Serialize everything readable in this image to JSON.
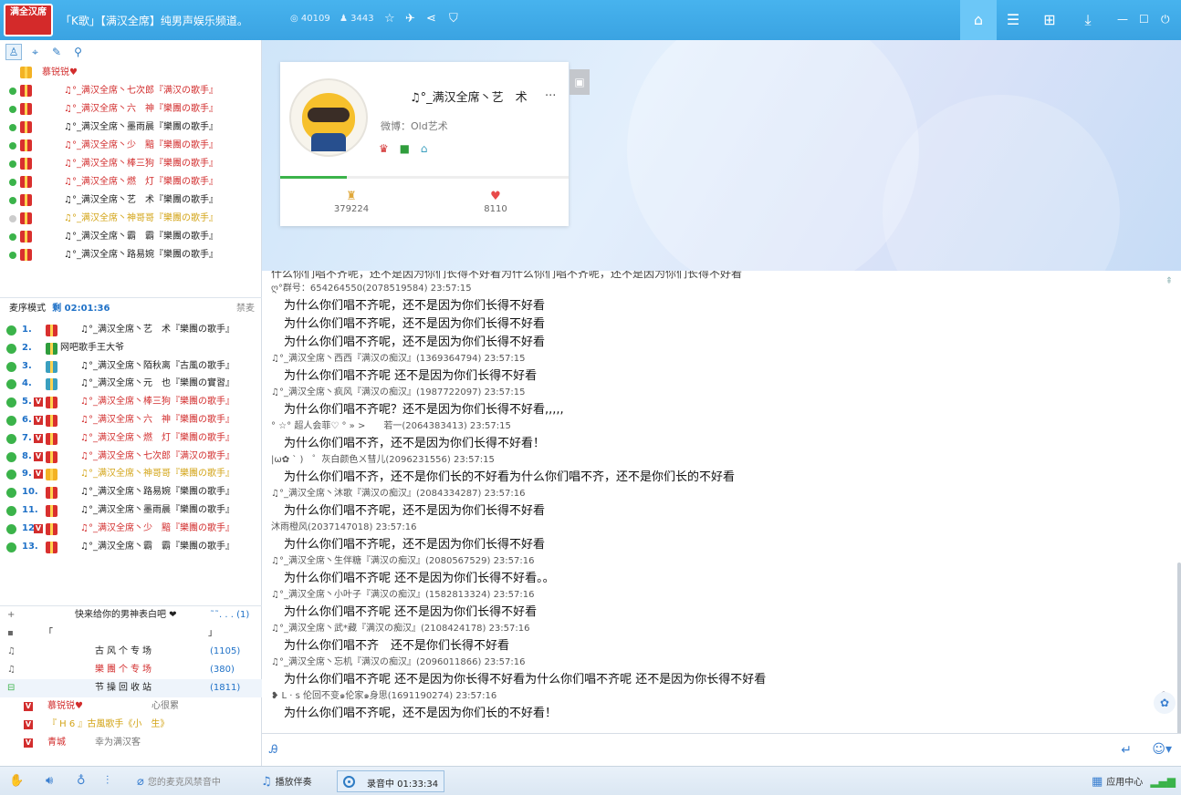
{
  "titlebar": {
    "logo": "满全汉席",
    "room_title": "「K歌」【满汉全席】纯男声娱乐频道。",
    "online": "40109",
    "members": "3443",
    "icons": [
      "star-icon",
      "plane-icon",
      "share-icon",
      "shield-icon"
    ],
    "right_icons": [
      "home-icon",
      "list-icon",
      "game-icon",
      "download-icon"
    ],
    "window": [
      "minimize-icon",
      "maximize-icon",
      "power-icon"
    ]
  },
  "left_tabs": [
    "user-icon",
    "location-icon",
    "edit-icon",
    "search-icon"
  ],
  "mic_list": {
    "host": "慕锐锐♥",
    "items": [
      {
        "name": "♫°_满汉全席丶七次郎『满汉の歌手』",
        "color": "red"
      },
      {
        "name": "♫°_满汉全席丶六　神『樂團の歌手』",
        "color": "red"
      },
      {
        "name": "♫°_满汉全席丶墨雨晨『樂團の歌手』",
        "color": "black"
      },
      {
        "name": "♫°_满汉全席丶少　黯『樂團の歌手』",
        "color": "red"
      },
      {
        "name": "♫°_满汉全席丶棒三狗『樂團の歌手』",
        "color": "red"
      },
      {
        "name": "♫°_满汉全席丶燃　灯『樂團の歌手』",
        "color": "red"
      },
      {
        "name": "♫°_满汉全席丶艺　术『樂團の歌手』",
        "color": "black"
      },
      {
        "name": "♫°_满汉全席丶神哥哥『樂團の歌手』",
        "color": "gold"
      },
      {
        "name": "♫°_满汉全席丶霸　霸『樂團の歌手』",
        "color": "black"
      },
      {
        "name": "♫°_满汉全席丶路易婉『樂團の歌手』",
        "color": "black"
      }
    ]
  },
  "queue": {
    "mode": "麦序模式",
    "remaining": "剩 02:01:36",
    "ban": "禁麦",
    "items": [
      {
        "num": "1.",
        "v": false,
        "name": "♫°_满汉全席丶艺　术『樂團の歌手』",
        "color": "black"
      },
      {
        "num": "2.",
        "v": false,
        "name": "网吧歌手王大爷",
        "color": "black"
      },
      {
        "num": "3.",
        "v": false,
        "name": "♫°_满汉全席丶陌秋离『古風の歌手』",
        "color": "black"
      },
      {
        "num": "4.",
        "v": false,
        "name": "♫°_满汉全席丶元　也『樂團の實習』",
        "color": "black"
      },
      {
        "num": "5.",
        "v": true,
        "name": "♫°_满汉全席丶棒三狗『樂團の歌手』",
        "color": "red"
      },
      {
        "num": "6.",
        "v": true,
        "name": "♫°_满汉全席丶六　神『樂團の歌手』",
        "color": "red"
      },
      {
        "num": "7.",
        "v": true,
        "name": "♫°_满汉全席丶燃　灯『樂團の歌手』",
        "color": "red"
      },
      {
        "num": "8.",
        "v": true,
        "name": "♫°_满汉全席丶七次郎『满汉の歌手』",
        "color": "red"
      },
      {
        "num": "9.",
        "v": true,
        "name": "♫°_满汉全席丶神哥哥『樂團の歌手』",
        "color": "gold"
      },
      {
        "num": "10.",
        "v": false,
        "name": "♫°_满汉全席丶路易婉『樂團の歌手』",
        "color": "black"
      },
      {
        "num": "11.",
        "v": false,
        "name": "♫°_满汉全席丶墨雨晨『樂團の歌手』",
        "color": "black"
      },
      {
        "num": "12.",
        "v": true,
        "name": "♫°_满汉全席丶少　黯『樂團の歌手』",
        "color": "red"
      },
      {
        "num": "13.",
        "v": false,
        "name": "♫°_满汉全席丶霸　霸『樂團の歌手』",
        "color": "black"
      }
    ]
  },
  "channels": {
    "headline": "快来给你的男神表白吧 ❤",
    "headline_extra": "˜˜. . . (1)",
    "bracket_left": "「",
    "bracket_right": "」",
    "items": [
      {
        "name": "古风个专场",
        "count": "(1105)",
        "color": "black"
      },
      {
        "name": "樂團个专场",
        "count": "(380)",
        "color": "red"
      },
      {
        "name": "节操回收站",
        "count": "(1811)",
        "color": "black"
      }
    ],
    "users": [
      {
        "name": "慕锐锐♥",
        "extra": "心很累"
      },
      {
        "name": "『 H 6 』古風歌手《小　生》",
        "extra": ""
      },
      {
        "name": "青城",
        "extra": "幸为满汉客"
      }
    ]
  },
  "profile": {
    "name": "♫°_满汉全席丶艺　术",
    "more": "...",
    "weibo": "微博：Old艺术",
    "progress": 0.23,
    "score": "379224",
    "likes": "8110"
  },
  "chat": {
    "top_partial": "什么你们唱不齐呢，还不是因为你们长得不好看为什么你们唱不齐呢，还不是因为你们长得不好看",
    "messages": [
      {
        "sender": "ღ°群号：654264550(2078519584) 23:57:15",
        "text": "为什么你们唱不齐呢，还不是因为你们长得不好看"
      },
      {
        "sender": "",
        "text": "为什么你们唱不齐呢，还不是因为你们长得不好看"
      },
      {
        "sender": "",
        "text": "为什么你们唱不齐呢，还不是因为你们长得不好看"
      },
      {
        "sender": "♫°_满汉全席丶西西『满汉の痴汉』(1369364794) 23:57:15",
        "text": "为什么你们唱不齐呢 还不是因为你们长得不好看"
      },
      {
        "sender": "♫°_满汉全席丶疯风『满汉の痴汉』(1987722097) 23:57:15",
        "text": "为什么你们唱不齐呢？还不是因为你们长得不好看,,,,,"
      },
      {
        "sender": "° ☆° 超人会菲♡ ° » >　　若一(2064383413) 23:57:15",
        "text": "为什么你们唱不齐，还不是因为你们长得不好看！"
      },
      {
        "sender": "|ω✿ ` )　゜灰白颜色ㄨ彗儿(2096231556) 23:57:15",
        "text": "为什么你们唱不齐，还不是你们长的不好看为什么你们唱不齐，还不是你们长的不好看"
      },
      {
        "sender": "♫°_满汉全席丶沐歌『满汉の痴汉』(2084334287) 23:57:16",
        "text": "为什么你们唱不齐呢，还不是因为你们长得不好看"
      },
      {
        "sender": "沐雨橙风(2037147018) 23:57:16",
        "text": "为什么你们唱不齐呢，还不是因为你们长得不好看"
      },
      {
        "sender": "♫°_满汉全席丶生伴糖『满汉の痴汉』(2080567529) 23:57:16",
        "text": "为什么你们唱不齐呢 还不是因为你们长得不好看。。"
      },
      {
        "sender": "♫°_满汉全席丶小叶子『满汉の痴汉』(1582813324) 23:57:16",
        "text": "为什么你们唱不齐呢 还不是因为你们长得不好看"
      },
      {
        "sender": "♫°_满汉全席丶武*藏『满汉の痴汉』(2108424178) 23:57:16",
        "text": "为什么你们唱不齐　还不是你们长得不好看"
      },
      {
        "sender": "♫°_满汉全席丶忘机『满汉の痴汉』(2096011866) 23:57:16",
        "text": "为什么你们唱不齐呢 还不是因为你长得不好看为什么你们唱不齐呢 还不是因为你长得不好看"
      },
      {
        "sender": "❥ L · s 伦回不变๑伦家๑身思(1691190274) 23:57:16",
        "text": "为什么你们唱不齐呢，还不是因为你们长的不好看！"
      }
    ]
  },
  "bottombar": {
    "mic_status": "您的麦克风禁音中",
    "accompany": "播放伴奏",
    "recording": "录音中 01:33:34",
    "app_center": "应用中心"
  },
  "colors": {
    "accent": "#3aa3e2",
    "red": "#d22d2d",
    "gold": "#d3a417",
    "green": "#3bb34a"
  }
}
